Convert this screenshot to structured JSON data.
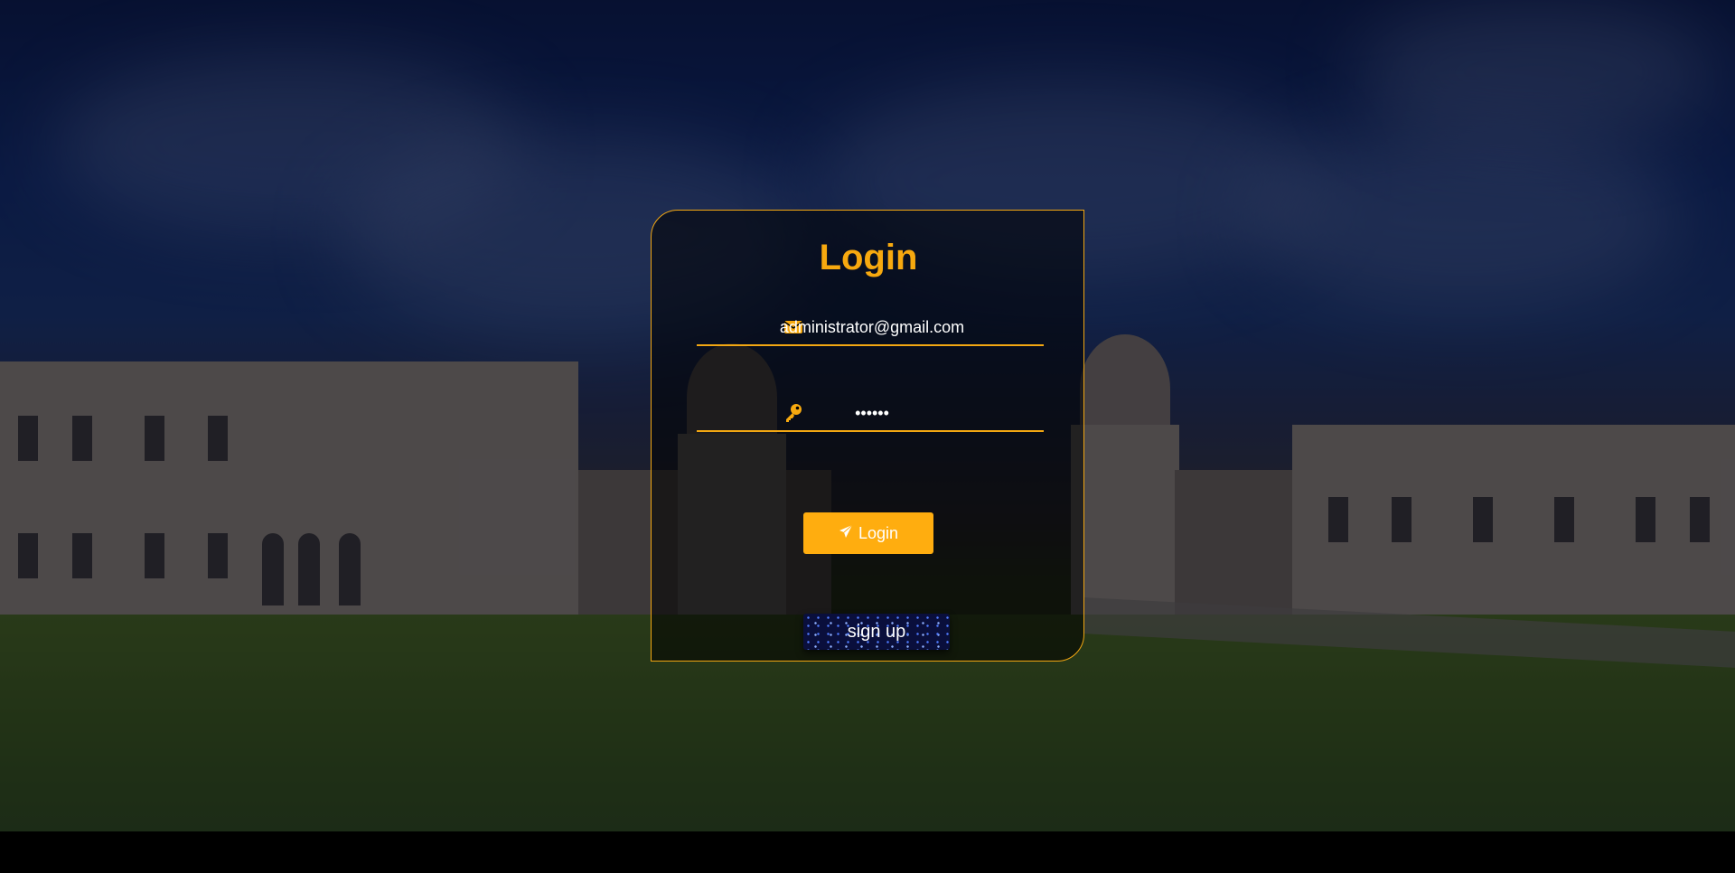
{
  "login_card": {
    "title": "Login",
    "email": {
      "value": "administrator@gmail.com",
      "icon": "envelope-icon"
    },
    "password": {
      "value": "••••••",
      "icon": "key-icon"
    },
    "login_button": {
      "label": "Login",
      "icon": "paper-plane-icon"
    },
    "signup_button": {
      "label": "sign up"
    }
  },
  "colors": {
    "accent": "#f7a90f",
    "button": "#ffad0f",
    "signup_bg": "#0a0f3c"
  }
}
